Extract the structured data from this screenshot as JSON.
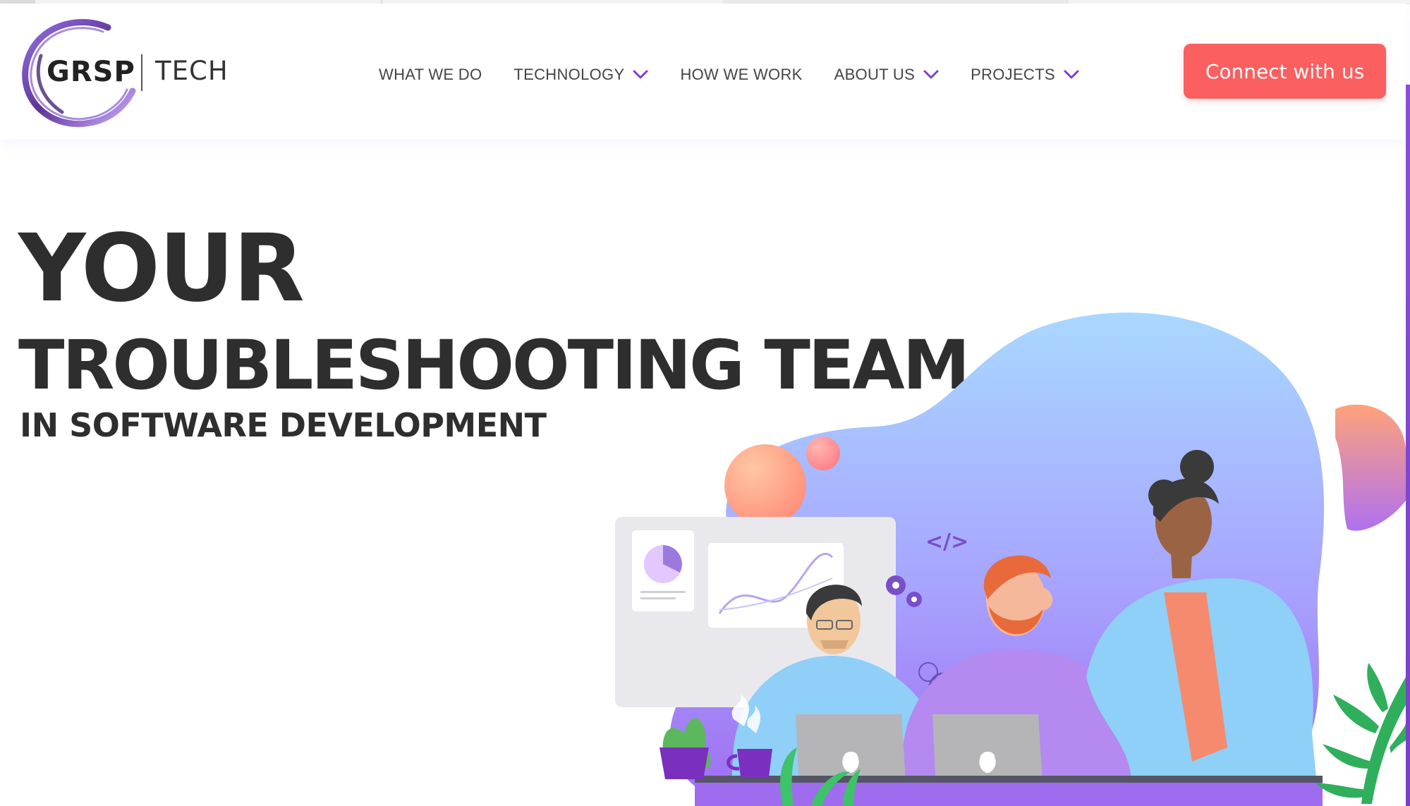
{
  "brand": {
    "name": "GRSP",
    "sub": "TECH",
    "ring_color": "#6a3fc4"
  },
  "nav": {
    "items": [
      {
        "label": "WHAT WE DO",
        "has_dropdown": false
      },
      {
        "label": "TECHNOLOGY",
        "has_dropdown": true
      },
      {
        "label": "HOW WE WORK",
        "has_dropdown": false
      },
      {
        "label": "ABOUT US",
        "has_dropdown": true
      },
      {
        "label": "PROJECTS",
        "has_dropdown": true
      }
    ],
    "chevron_icon": "chevron-down-icon",
    "accent": "#7b3fd0"
  },
  "cta": {
    "label": "Connect with us",
    "color": "#fb5f5f"
  },
  "hero": {
    "line1": "YOUR",
    "line2": "TROUBLESHOOTING TEAM",
    "line3": "IN SOFTWARE DEVELOPMENT",
    "text_color": "#2e2e2e"
  },
  "illustration": {
    "code_tag": "</>",
    "icons": [
      "gear-icon",
      "search-user-icon",
      "apple-logo-icon",
      "pie-chart-icon",
      "line-chart-icon",
      "plant-icon",
      "cactus-icon",
      "coffee-cup-icon"
    ]
  }
}
